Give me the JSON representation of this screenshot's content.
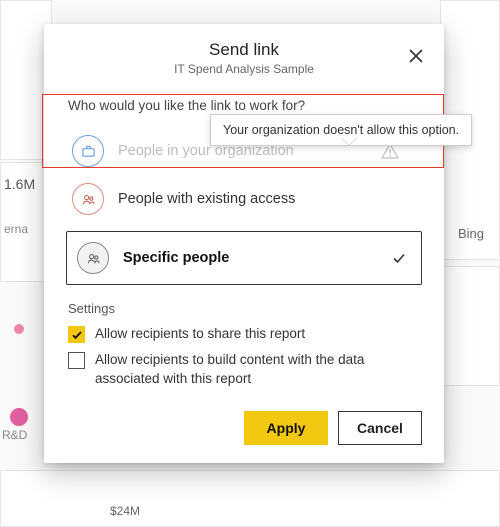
{
  "dialog": {
    "title": "Send link",
    "subtitle": "IT Spend Analysis Sample",
    "question": "Who would you like the link to work for?",
    "tooltip": "Your organization doesn't allow this option.",
    "options": {
      "org": {
        "label": "People in your organization"
      },
      "existing": {
        "label": "People with existing access"
      },
      "specific": {
        "label": "Specific people"
      }
    },
    "settings": {
      "header": "Settings",
      "allow_share": {
        "label": "Allow recipients to share this report",
        "checked": true
      },
      "allow_build": {
        "label": "Allow recipients to build content with the data associated with this report",
        "checked": false
      }
    },
    "buttons": {
      "apply": "Apply",
      "cancel": "Cancel"
    }
  },
  "background": {
    "left_value": "1.6M",
    "left_label": "erna",
    "rd_label": "R&D",
    "bottom_value": "$24M",
    "map_attr": "Bing"
  }
}
